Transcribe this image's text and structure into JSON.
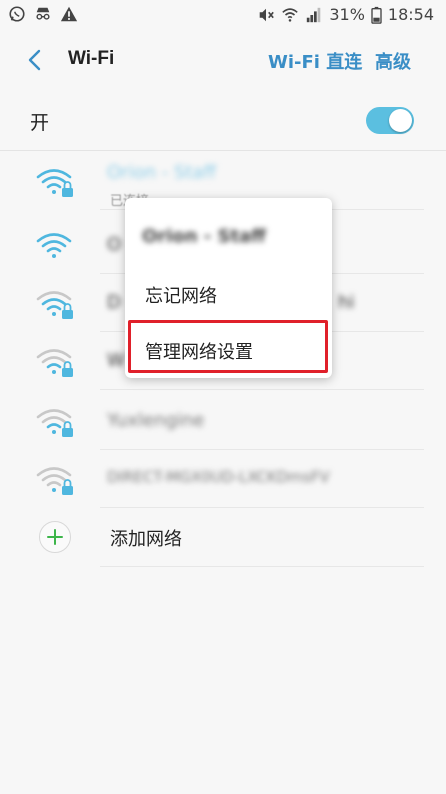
{
  "status_bar": {
    "battery": "31%",
    "time": "18:54"
  },
  "header": {
    "title": "Wi-Fi",
    "wifi_direct": "Wi-Fi 直连",
    "advanced": "高级"
  },
  "toggle": {
    "label": "开",
    "state": "on",
    "color": "#5bbfe0"
  },
  "networks": [
    {
      "name": "Orion - Staff",
      "status": "已连接",
      "connected": true,
      "secured": true,
      "signal": "full"
    },
    {
      "name": "O",
      "connected": false,
      "secured": false,
      "signal": "full"
    },
    {
      "name": "D",
      "trailing": "hi",
      "connected": false,
      "secured": true,
      "signal": "weak"
    },
    {
      "name": "W",
      "connected": false,
      "secured": true,
      "signal": "weak"
    },
    {
      "name": "Yuxlengine",
      "connected": false,
      "secured": true,
      "signal": "weak"
    },
    {
      "name": "DIRECT-MGX0UD-LXCKDmsFV",
      "connected": false,
      "secured": true,
      "signal": "weak"
    }
  ],
  "add_network": "添加网络",
  "popup": {
    "title": "Orion - Staff",
    "items": [
      "忘记网络",
      "管理网络设置"
    ],
    "highlighted_item": "管理网络设置"
  },
  "colors": {
    "accent": "#3a8ec6",
    "wifi_active": "#4fb7df",
    "wifi_weak": "#c8c8c8",
    "highlight": "#e0202a"
  }
}
